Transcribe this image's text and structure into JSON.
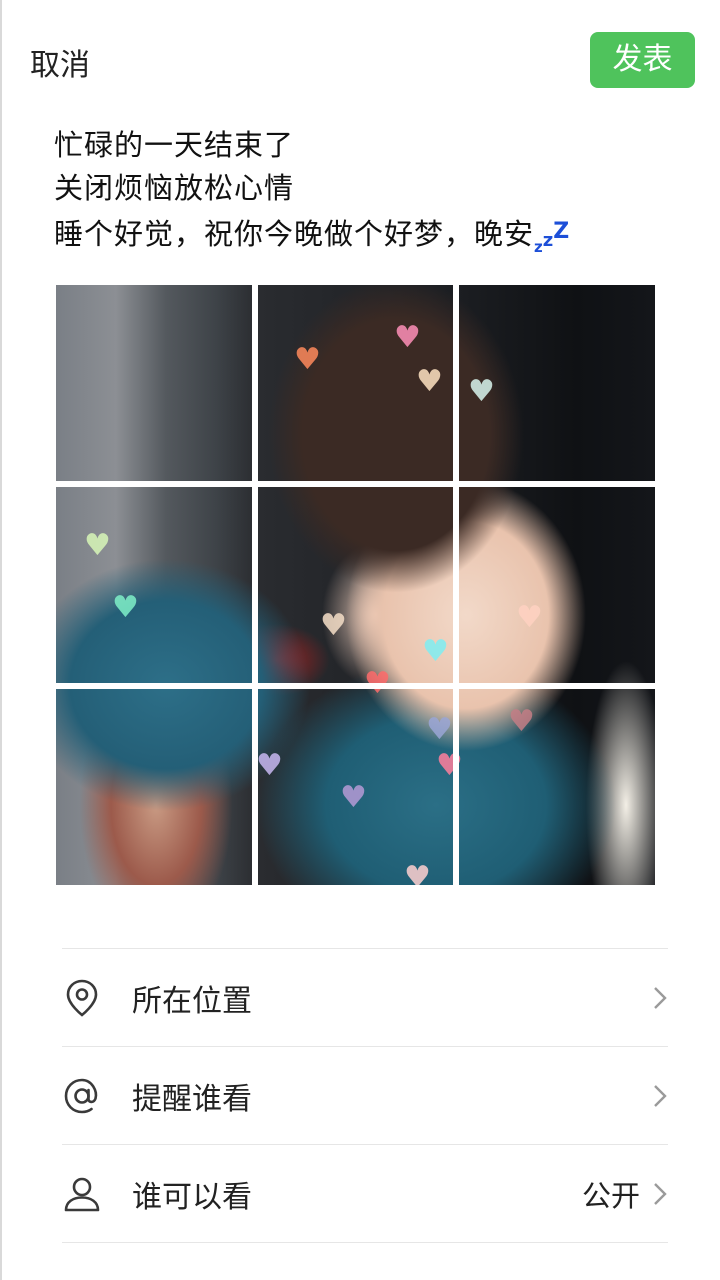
{
  "header": {
    "cancel_label": "取消",
    "publish_label": "发表",
    "publish_color": "#4fc35c"
  },
  "post": {
    "lines": [
      "忙碌的一天结束了",
      "关闭烦恼放松心情",
      "睡个好觉，祝你今晚做个好梦，晚安"
    ],
    "emoji": "zzz",
    "emoji_color": "#1d4fd8"
  },
  "photo": {
    "layout": "3x3 nine-grid",
    "description_icon": "photo-grid"
  },
  "options": [
    {
      "icon": "location-pin-icon",
      "label": "所在位置",
      "value": ""
    },
    {
      "icon": "at-sign-icon",
      "label": "提醒谁看",
      "value": ""
    },
    {
      "icon": "person-icon",
      "label": "谁可以看",
      "value": "公开"
    }
  ]
}
